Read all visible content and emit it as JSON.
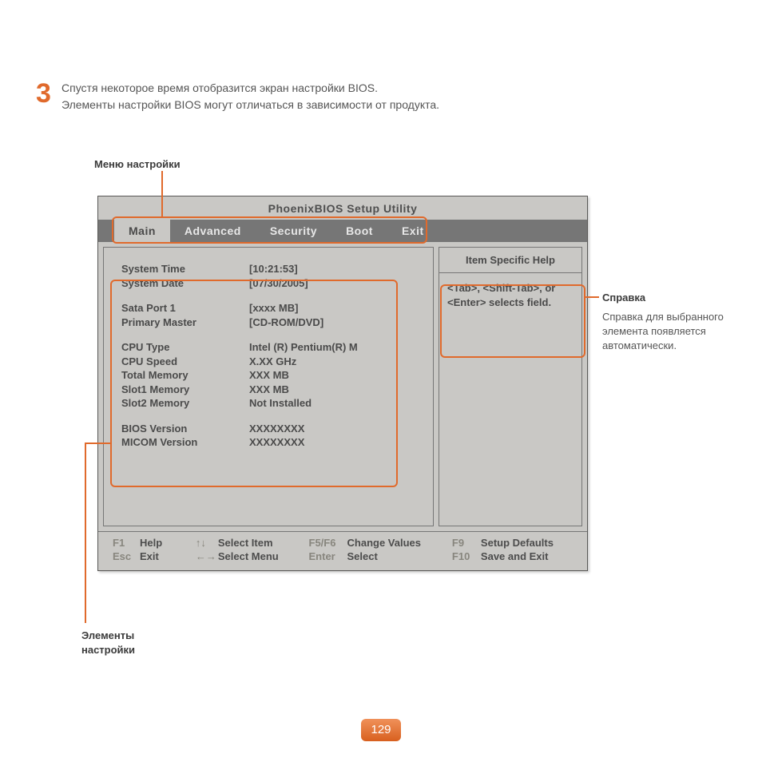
{
  "step": {
    "number": "3",
    "line1": "Спустя некоторое время отобразится экран настройки BIOS.",
    "line2": "Элементы настройки BIOS могут отличаться в зависимости от продукта."
  },
  "labels": {
    "menu": "Меню настройки",
    "help_title": "Справка",
    "help_text": "Справка для выбранного элемента появляется автоматически.",
    "elements_l1": "Элементы",
    "elements_l2": "настройки"
  },
  "bios": {
    "title": "PhoenixBIOS Setup Utility",
    "tabs": [
      "Main",
      "Advanced",
      "Security",
      "Boot",
      "Exit"
    ],
    "system_time_label": "System Time",
    "system_time_value": "[10:21:53]",
    "system_date_label": "System Date",
    "system_date_value": "[07/30/2005]",
    "sata_port1_label": "Sata Port 1",
    "sata_port1_value": "[xxxx MB]",
    "primary_master_label": "Primary Master",
    "primary_master_value": "[CD-ROM/DVD]",
    "cpu_type_label": "CPU Type",
    "cpu_type_value": "Intel (R) Pentium(R) M",
    "cpu_speed_label": "CPU Speed",
    "cpu_speed_value": "X.XX GHz",
    "total_memory_label": "Total Memory",
    "total_memory_value": "XXX MB",
    "slot1_memory_label": "Slot1 Memory",
    "slot1_memory_value": "XXX MB",
    "slot2_memory_label": "Slot2 Memory",
    "slot2_memory_value": "Not Installed",
    "bios_version_label": "BIOS Version",
    "bios_version_value": "XXXXXXXX",
    "micom_version_label": "MICOM Version",
    "micom_version_value": "XXXXXXXX",
    "help_panel_title": "Item Specific Help",
    "help_panel_body": "<Tab>, <Shift-Tab>, or <Enter> selects field.",
    "footer": {
      "f1_key": "F1",
      "f1_action": "Help",
      "esc_key": "Esc",
      "esc_action": "Exit",
      "updown_key": "↑↓",
      "updown_action": "Select Item",
      "leftright_key": "←→",
      "leftright_action": "Select Menu",
      "f5f6_key": "F5/F6",
      "f5f6_action": "Change Values",
      "enter_key": "Enter",
      "enter_action": "Select",
      "f9_key": "F9",
      "f9_action": "Setup Defaults",
      "f10_key": "F10",
      "f10_action": "Save and Exit"
    }
  },
  "page_number": "129"
}
